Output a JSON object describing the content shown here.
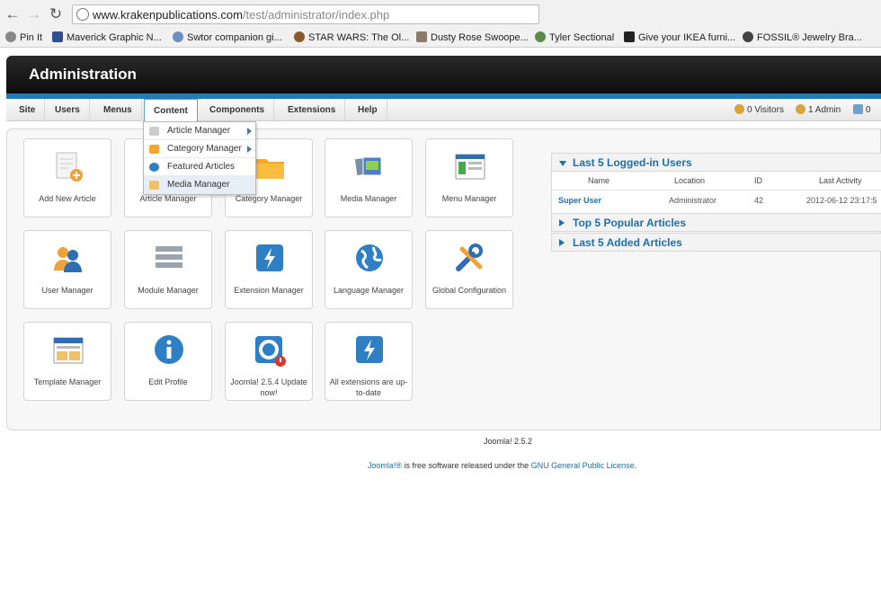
{
  "browser": {
    "url_host": "www.krakenpublications.com",
    "url_path": "/test/administrator/index.php",
    "bookmarks": [
      "Pin It",
      "Maverick Graphic N...",
      "Swtor companion gi...",
      "STAR WARS: The Ol...",
      "Dusty Rose Swoope...",
      "Tyler Sectional",
      "Give your IKEA furni...",
      "FOSSIL® Jewelry Bra..."
    ]
  },
  "header": {
    "title": "Administration"
  },
  "menu": {
    "items": [
      "Site",
      "Users",
      "Menus",
      "Content",
      "Components",
      "Extensions",
      "Help"
    ],
    "visitors": "0 Visitors",
    "admins": "1 Admin",
    "other": "0"
  },
  "dropdown": {
    "items": [
      "Article Manager",
      "Category Manager",
      "Featured Articles",
      "Media Manager"
    ]
  },
  "tiles": [
    {
      "label": "Add New Article"
    },
    {
      "label": "Article Manager"
    },
    {
      "label": "Category Manager"
    },
    {
      "label": "Media Manager"
    },
    {
      "label": "Menu Manager"
    },
    {
      "label": "User Manager"
    },
    {
      "label": "Module Manager"
    },
    {
      "label": "Extension Manager"
    },
    {
      "label": "Language Manager"
    },
    {
      "label": "Global Configuration"
    },
    {
      "label": "Template Manager"
    },
    {
      "label": "Edit Profile"
    },
    {
      "label": "Joomla! 2.5.4 Update now!"
    },
    {
      "label": "All extensions are up-to-date"
    }
  ],
  "widget": {
    "logged_in_title": "Last 5 Logged-in Users",
    "popular_title": "Top 5 Popular Articles",
    "added_title": "Last 5 Added Articles",
    "columns": [
      "Name",
      "Location",
      "ID",
      "Last Activity"
    ],
    "row": {
      "name": "Super User",
      "location": "Administrator",
      "id": "42",
      "last_activity": "2012-06-12 23:17:5"
    }
  },
  "footer": {
    "version": "Joomla! 2.5.2",
    "brand_link": "Joomla!®",
    "middle": " is free software released under the ",
    "license_link": "GNU General Public License",
    "end": "."
  },
  "colors": {
    "accent": "#1f7cb6",
    "link": "#1f6fa8",
    "header_bg": "#111111"
  }
}
